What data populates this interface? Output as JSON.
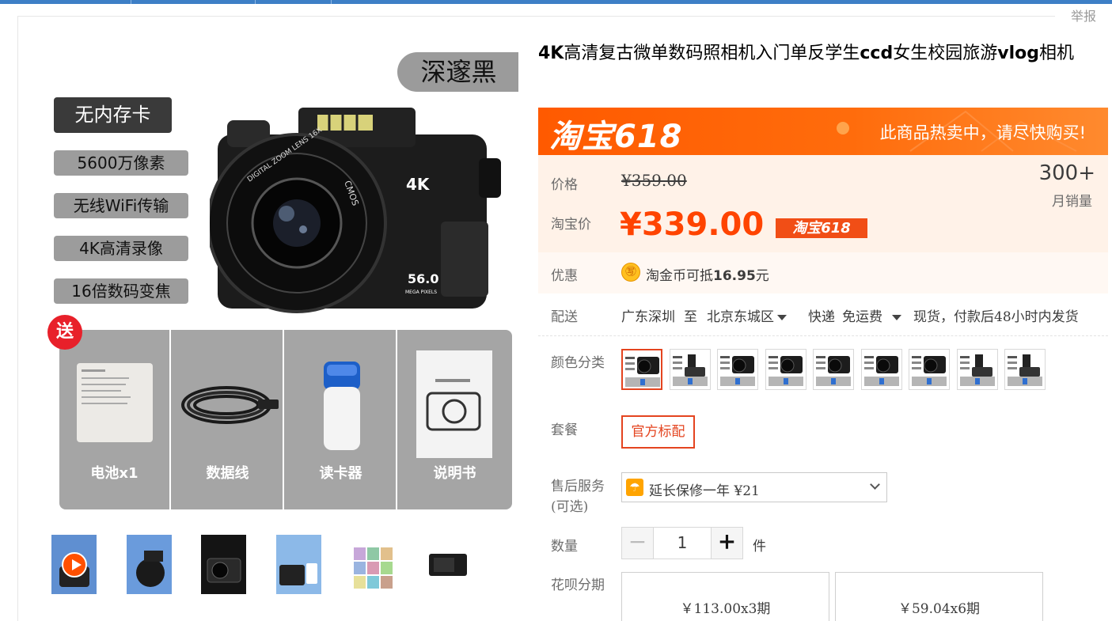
{
  "page": {
    "report_label": "举报"
  },
  "gallery": {
    "main_image": {
      "color_tag": "深邃黑",
      "features": [
        "无内存卡",
        "5600万像素",
        "无线WiFi传输",
        "4K高清录像",
        "16倍数码变焦"
      ],
      "camera_badge": "4K",
      "camera_lens_text": "DIGITAL ZOOM LENS 16X",
      "camera_side_text": "CMOS",
      "camera_pixels": "56.0",
      "camera_pixels_sub": "MEGA PIXELS",
      "gift_badge": "送",
      "accessories": [
        "电池x1",
        "数据线",
        "读卡器",
        "说明书"
      ]
    },
    "thumbnails": [
      {
        "kind": "video",
        "icon": "play-icon"
      },
      {
        "kind": "image"
      },
      {
        "kind": "image"
      },
      {
        "kind": "image"
      },
      {
        "kind": "image"
      },
      {
        "kind": "image"
      }
    ]
  },
  "product": {
    "title_parts": [
      {
        "text": "4K",
        "bold": true
      },
      {
        "text": "高清复古微单数码照相机入门单反学生",
        "bold": false
      },
      {
        "text": "ccd",
        "bold": true
      },
      {
        "text": "女生校园旅游",
        "bold": false
      },
      {
        "text": "vlog",
        "bold": true
      },
      {
        "text": "相机",
        "bold": false
      }
    ],
    "promo": {
      "logo": "淘宝618",
      "text": "此商品热卖中，请尽快购买!"
    },
    "price": {
      "label": "价格",
      "original": "¥359.00",
      "taobao_label": "淘宝价",
      "current": "¥339.00",
      "tag": "淘宝618"
    },
    "sales": {
      "count": "300+",
      "label": "月销量"
    },
    "discount": {
      "label": "优惠",
      "icon": "coin-icon",
      "icon_char": "㊢",
      "text_prefix": "淘金币可抵",
      "amount": "16.95",
      "unit": "元"
    },
    "shipping": {
      "label": "配送",
      "from": "广东深圳",
      "to_word": "至",
      "destination": "北京东城区",
      "method": "快递",
      "fee": "免运费",
      "availability": "现货，付款后48小时内发货"
    },
    "colors": {
      "label": "颜色分类",
      "count": 9,
      "selected_index": 0
    },
    "package": {
      "label": "套餐",
      "option": "官方标配"
    },
    "service": {
      "label_line1": "售后服务",
      "label_line2": "(可选)",
      "icon": "umbrella-icon",
      "selected": "延长保修一年 ¥21"
    },
    "quantity": {
      "label": "数量",
      "minus": "−",
      "value": "1",
      "plus": "+",
      "unit": "件"
    },
    "installment": {
      "label": "花呗分期",
      "options": [
        "￥113.00x3期",
        "￥59.04x6期"
      ]
    }
  },
  "colors_theme": {
    "accent": "#ff4400",
    "promo_orange": "#ff5a00",
    "price_bg": "#fff2e8",
    "selected_border": "#e4441f"
  }
}
